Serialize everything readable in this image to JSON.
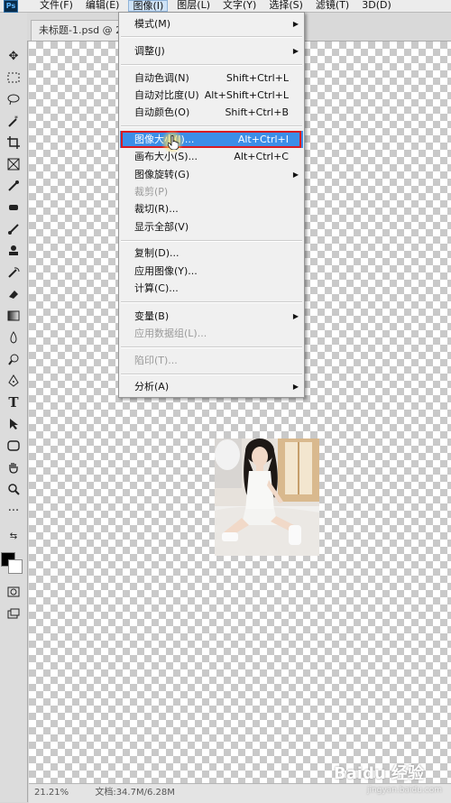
{
  "menubar": {
    "logo": "Ps",
    "items": [
      {
        "label": "文件(F)"
      },
      {
        "label": "编辑(E)"
      },
      {
        "label": "图像(I)"
      },
      {
        "label": "图层(L)"
      },
      {
        "label": "文字(Y)"
      },
      {
        "label": "选择(S)"
      },
      {
        "label": "滤镜(T)"
      },
      {
        "label": "3D(D)"
      }
    ]
  },
  "document": {
    "tab_title": "未标题-1.psd @ 2"
  },
  "image_menu": {
    "items": [
      {
        "label": "模式(M)",
        "shortcut": "",
        "submenu": true
      },
      {
        "label": "调整(J)",
        "shortcut": "",
        "submenu": true
      },
      {
        "label": "自动色调(N)",
        "shortcut": "Shift+Ctrl+L"
      },
      {
        "label": "自动对比度(U)",
        "shortcut": "Alt+Shift+Ctrl+L"
      },
      {
        "label": "自动颜色(O)",
        "shortcut": "Shift+Ctrl+B"
      },
      {
        "label": "图像大小(I)...",
        "shortcut": "Alt+Ctrl+I",
        "highlighted": true
      },
      {
        "label": "画布大小(S)...",
        "shortcut": "Alt+Ctrl+C"
      },
      {
        "label": "图像旋转(G)",
        "shortcut": "",
        "submenu": true
      },
      {
        "label": "裁剪(P)",
        "shortcut": "",
        "disabled": true
      },
      {
        "label": "裁切(R)...",
        "shortcut": ""
      },
      {
        "label": "显示全部(V)",
        "shortcut": ""
      },
      {
        "label": "复制(D)...",
        "shortcut": ""
      },
      {
        "label": "应用图像(Y)...",
        "shortcut": ""
      },
      {
        "label": "计算(C)...",
        "shortcut": ""
      },
      {
        "label": "变量(B)",
        "shortcut": "",
        "submenu": true
      },
      {
        "label": "应用数据组(L)...",
        "shortcut": "",
        "disabled": true
      },
      {
        "label": "陷印(T)...",
        "shortcut": "",
        "disabled": true
      },
      {
        "label": "分析(A)",
        "shortcut": "",
        "submenu": true
      }
    ]
  },
  "statusbar": {
    "zoom": "21.21%",
    "doc_info": "文档:34.7M/6.28M"
  },
  "watermark": {
    "brand": "Baidu 经验",
    "url": "jingyan.baidu.com"
  },
  "colors": {
    "highlight": "#3b8ee8",
    "annotation_box": "#d81b22"
  }
}
